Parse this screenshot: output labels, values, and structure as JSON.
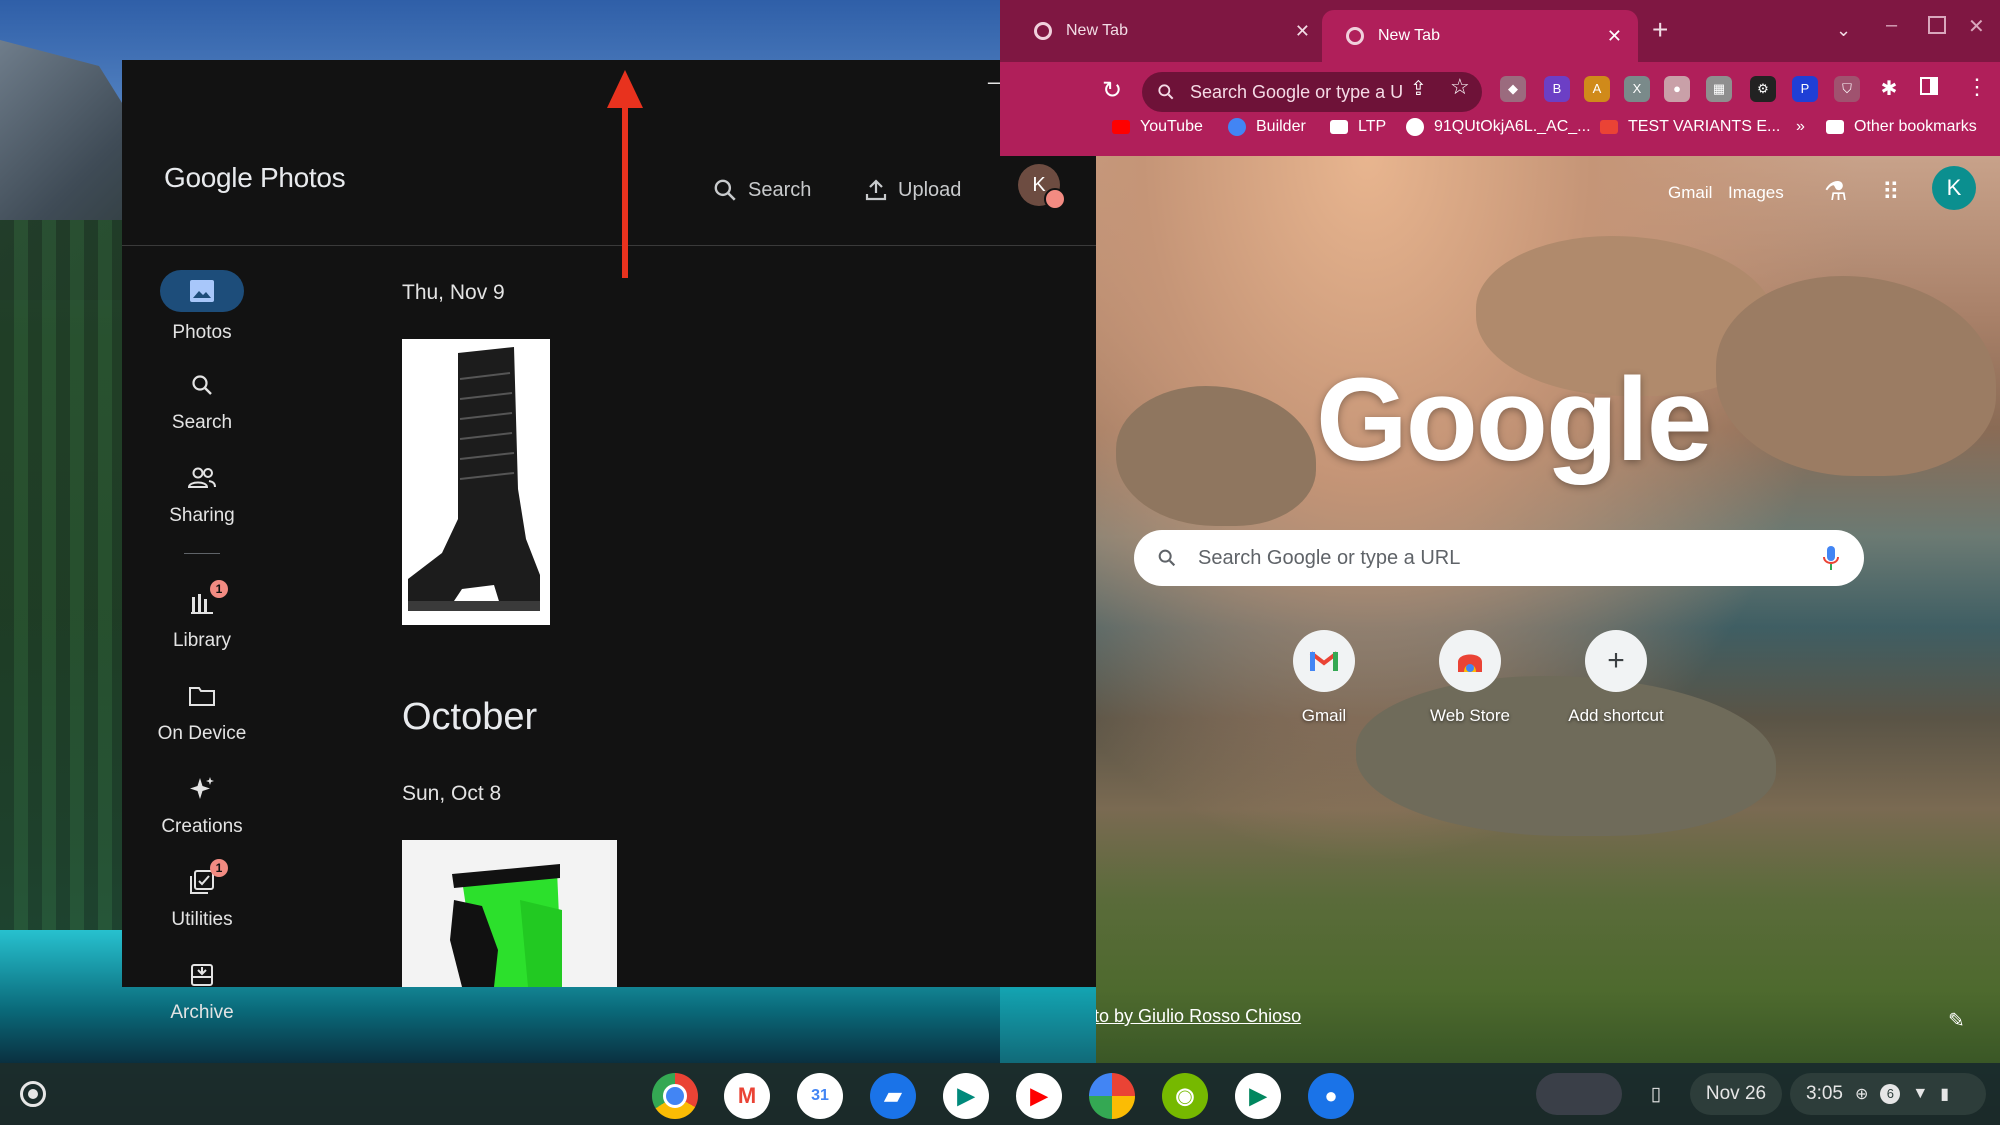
{
  "photos_app": {
    "logo_google": "Google",
    "logo_photos": "Photos",
    "search_label": "Search",
    "upload_label": "Upload",
    "avatar_initial": "K",
    "nav": [
      {
        "label": "Photos"
      },
      {
        "label": "Search"
      },
      {
        "label": "Sharing"
      },
      {
        "label": "Library",
        "badge": "1"
      },
      {
        "label": "On Device"
      },
      {
        "label": "Creations"
      },
      {
        "label": "Utilities",
        "badge": "1"
      },
      {
        "label": "Archive"
      }
    ],
    "sections": {
      "date1": "Thu, Nov 9",
      "month": "October",
      "date2": "Sun, Oct 8"
    }
  },
  "chrome": {
    "tabs": [
      {
        "title": "New Tab"
      },
      {
        "title": "New Tab"
      }
    ],
    "omnibox_placeholder": "Search Google or type a U",
    "bookmarks": [
      "YouTube",
      "Builder",
      "LTP",
      "91QUtOkjA6L._AC_...",
      "TEST VARIANTS E...",
      "Other bookmarks"
    ],
    "overflow_chevron": "»",
    "ntp": {
      "links": [
        "Gmail",
        "Images"
      ],
      "avatar_initial": "K",
      "logo": "Google",
      "search_placeholder": "Search Google or type a URL",
      "shortcuts": [
        "Gmail",
        "Web Store",
        "Add shortcut"
      ],
      "attribution": "Photo by Giulio Rosso Chioso"
    }
  },
  "shelf": {
    "date": "Nov 26",
    "time": "3:05",
    "notification_count": "6"
  },
  "colors": {
    "chrome_tabstrip": "#7f1742",
    "chrome_toolbar": "#b01f5a",
    "photos_bg": "#121212",
    "photos_nav_active": "#1d4d7a",
    "annotation_arrow": "#e8321e"
  }
}
